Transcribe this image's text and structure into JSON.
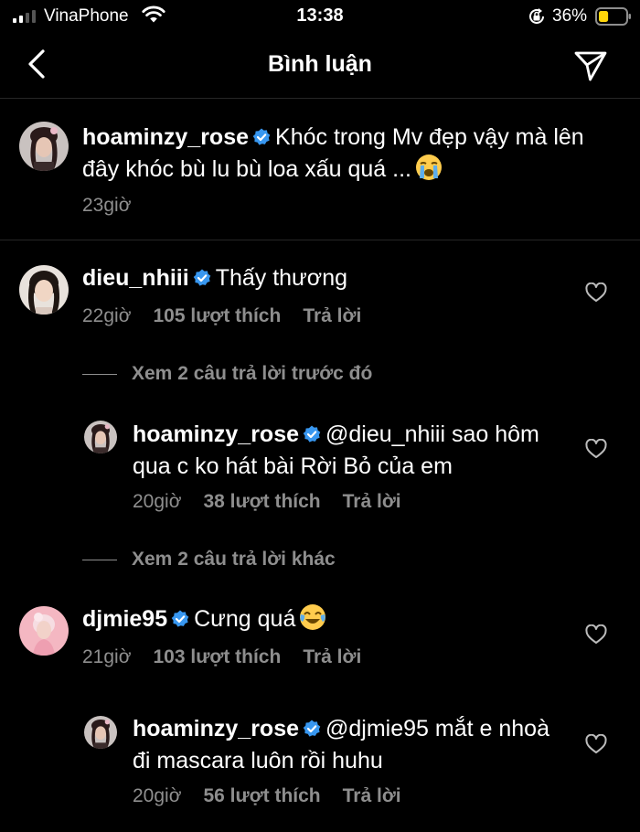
{
  "status_bar": {
    "carrier": "VinaPhone",
    "time": "13:38",
    "battery_percent": "36%",
    "battery_level": 0.36,
    "battery_color": "#FFD60A"
  },
  "header": {
    "title": "Bình luận",
    "back_icon": "chevron-left-icon",
    "share_icon": "paper-plane-icon"
  },
  "caption": {
    "username": "hoaminzy_rose",
    "text": "Khóc trong Mv đẹp vậy mà lên đây khóc bù lu bù loa xấu quá ...",
    "emoji": "loudly-crying-face",
    "time": "23giờ"
  },
  "comments": [
    {
      "username": "dieu_nhiii",
      "text": "Thấy thương",
      "time": "22giờ",
      "likes": "105 lượt thích",
      "reply": "Trả lời"
    },
    {
      "view_more": "Xem 2 câu trả lời trước đó"
    },
    {
      "username": "hoaminzy_rose",
      "text": "@dieu_nhiii sao hôm qua c ko hát bài Rời Bỏ của em",
      "time": "20giờ",
      "likes": "38 lượt thích",
      "reply": "Trả lời"
    },
    {
      "view_more": "Xem 2 câu trả lời khác"
    },
    {
      "username": "djmie95",
      "text": "Cưng quá",
      "emoji": "face-with-tears-of-joy",
      "time": "21giờ",
      "likes": "103 lượt thích",
      "reply": "Trả lời"
    },
    {
      "username": "hoaminzy_rose",
      "text": "@djmie95 mắt e nhoà đi mascara luôn rồi huhu",
      "time": "20giờ",
      "likes": "56 lượt thích",
      "reply": "Trả lời"
    }
  ],
  "colors": {
    "background": "#000000",
    "secondary_text": "#8E8E8E",
    "verified_badge": "#3897F0",
    "divider": "#262626"
  }
}
